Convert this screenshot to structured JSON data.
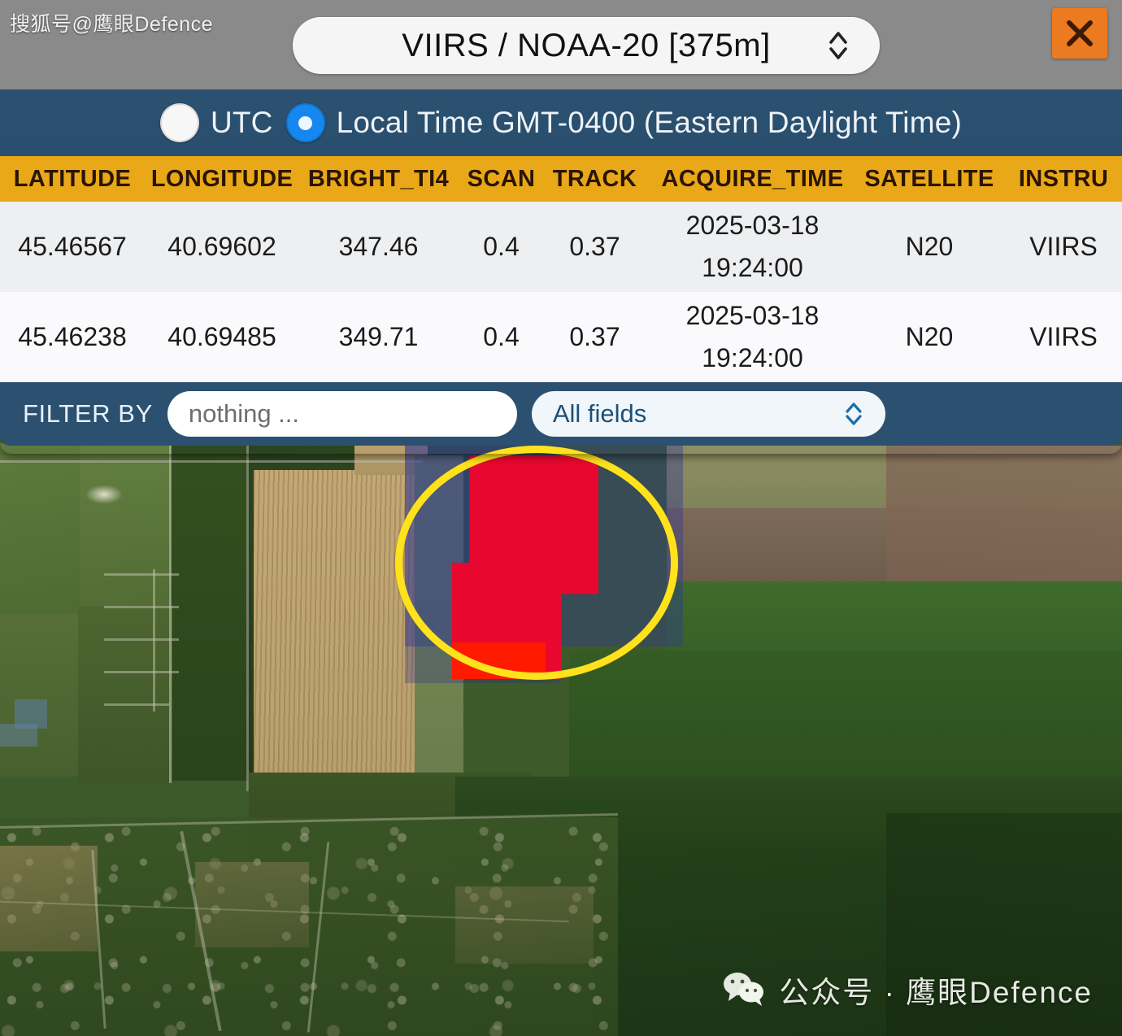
{
  "watermarks": {
    "top_left": "搜狐号@鹰眼Defence",
    "bottom_right": "公众号 · 鹰眼Defence"
  },
  "panel": {
    "sensor_select": {
      "value": "VIIRS / NOAA-20 [375m]",
      "icon": "chevron-updown-icon"
    },
    "close_label": "✕",
    "time_mode": {
      "options": [
        {
          "label": "UTC",
          "selected": false
        },
        {
          "label": "Local Time GMT-0400 (Eastern Daylight Time)",
          "selected": true
        }
      ]
    },
    "table": {
      "columns": [
        "LATITUDE",
        "LONGITUDE",
        "BRIGHT_TI4",
        "SCAN",
        "TRACK",
        "ACQUIRE_TIME",
        "SATELLITE",
        "INSTRU"
      ],
      "rows": [
        {
          "latitude": "45.46567",
          "longitude": "40.69602",
          "bright_ti4": "347.46",
          "scan": "0.4",
          "track": "0.37",
          "acquire_date": "2025-03-18",
          "acquire_clock": "19:24:00",
          "satellite": "N20",
          "instrument": "VIIRS"
        },
        {
          "latitude": "45.46238",
          "longitude": "40.69485",
          "bright_ti4": "349.71",
          "scan": "0.4",
          "track": "0.37",
          "acquire_date": "2025-03-18",
          "acquire_clock": "19:24:00",
          "satellite": "N20",
          "instrument": "VIIRS"
        }
      ]
    },
    "filter": {
      "label": "FILTER BY",
      "input_value": "",
      "input_placeholder": "nothing ...",
      "field_scope": "All fields",
      "field_scope_icon": "chevron-updown-icon"
    }
  },
  "map": {
    "detection_marker": {
      "ring_color": "#ffe21c",
      "footprint_color": "#303896",
      "hotspot_color": "#e8082f"
    }
  },
  "colors": {
    "panel_topbar": "#8a8a8a",
    "time_bar": "#2b5070",
    "table_header": "#e9a817",
    "close_button": "#ec7a20",
    "radio_selected": "#1787f0"
  }
}
